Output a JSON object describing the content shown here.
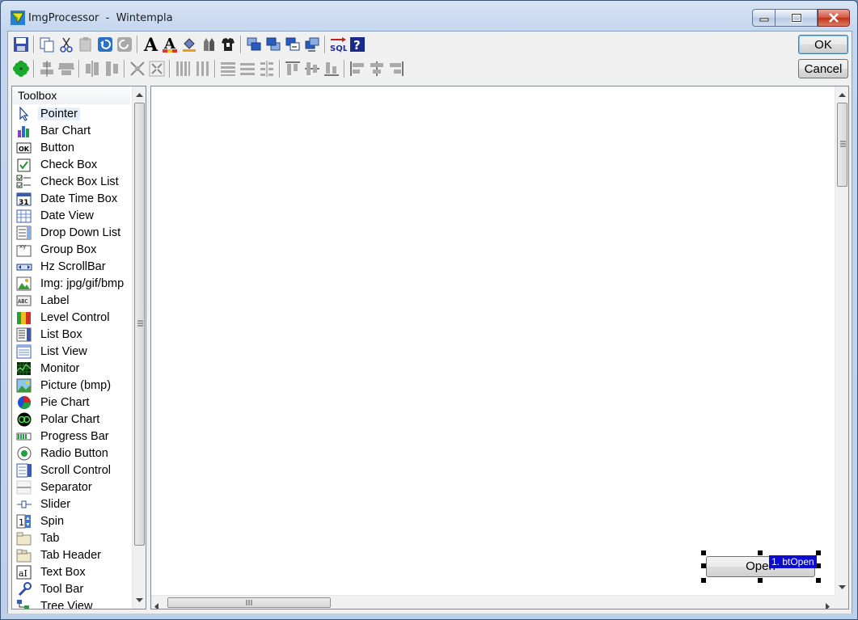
{
  "window": {
    "app_name": "ImgProcessor",
    "separator": "-",
    "doc_name": "Wintempla"
  },
  "dialog_buttons": {
    "ok_label": "OK",
    "cancel_label": "Cancel"
  },
  "toolbar": {
    "row1": [
      "save-icon",
      "copy-icon",
      "cut-icon",
      "paste-icon",
      "undo-icon",
      "redo-icon",
      "font-icon",
      "font-color-icon",
      "fill-color-icon",
      "pencils-icon",
      "tshirt-icon",
      "bring-forward-icon",
      "send-backward-icon",
      "swap-order-icon",
      "tab-order-icon",
      "sql-icon",
      "help-icon"
    ],
    "row2": [
      "flower-icon",
      "center-horizontal-icon",
      "center-vertical-icon",
      "space-horizontal-icon",
      "space-vertical-icon",
      "same-size-icon",
      "shrink-icon",
      "distribute-columns-icon",
      "distribute-columns-alt-icon",
      "distribute-rows-icon",
      "distribute-rows-alt-icon",
      "grid-rows-icon",
      "align-top-icon",
      "align-middle-icon",
      "align-bottom-icon",
      "align-left-icon",
      "align-center-icon",
      "align-right-icon"
    ]
  },
  "toolbox": {
    "header": "Toolbox",
    "selected": "Pointer",
    "items": [
      {
        "label": "Pointer",
        "icon": "pointer-icon"
      },
      {
        "label": "Bar Chart",
        "icon": "bar-chart-icon"
      },
      {
        "label": "Button",
        "icon": "button-icon"
      },
      {
        "label": "Check Box",
        "icon": "check-box-icon"
      },
      {
        "label": "Check Box List",
        "icon": "check-box-list-icon"
      },
      {
        "label": "Date Time Box",
        "icon": "date-time-box-icon"
      },
      {
        "label": "Date View",
        "icon": "date-view-icon"
      },
      {
        "label": "Drop Down List",
        "icon": "drop-down-list-icon"
      },
      {
        "label": "Group Box",
        "icon": "group-box-icon"
      },
      {
        "label": "Hz ScrollBar",
        "icon": "hz-scrollbar-icon"
      },
      {
        "label": "Img: jpg/gif/bmp",
        "icon": "image-icon"
      },
      {
        "label": "Label",
        "icon": "label-icon"
      },
      {
        "label": "Level Control",
        "icon": "level-control-icon"
      },
      {
        "label": "List Box",
        "icon": "list-box-icon"
      },
      {
        "label": "List View",
        "icon": "list-view-icon"
      },
      {
        "label": "Monitor",
        "icon": "monitor-icon"
      },
      {
        "label": "Picture (bmp)",
        "icon": "picture-icon"
      },
      {
        "label": "Pie Chart",
        "icon": "pie-chart-icon"
      },
      {
        "label": "Polar Chart",
        "icon": "polar-chart-icon"
      },
      {
        "label": "Progress Bar",
        "icon": "progress-bar-icon"
      },
      {
        "label": "Radio Button",
        "icon": "radio-button-icon"
      },
      {
        "label": "Scroll Control",
        "icon": "scroll-control-icon"
      },
      {
        "label": "Separator",
        "icon": "separator-icon"
      },
      {
        "label": "Slider",
        "icon": "slider-icon"
      },
      {
        "label": "Spin",
        "icon": "spin-icon"
      },
      {
        "label": "Tab",
        "icon": "tab-icon"
      },
      {
        "label": "Tab Header",
        "icon": "tab-header-icon"
      },
      {
        "label": "Text Box",
        "icon": "text-box-icon"
      },
      {
        "label": "Tool Bar",
        "icon": "tool-bar-icon"
      },
      {
        "label": "Tree View",
        "icon": "tree-view-icon"
      }
    ]
  },
  "designer": {
    "control_text": "Open",
    "control_tag": "1. btOpen"
  },
  "colors": {
    "selection_tag": "#0a0ad0",
    "title_gradient": "#c4d6ee",
    "close_button": "#c2301b"
  }
}
